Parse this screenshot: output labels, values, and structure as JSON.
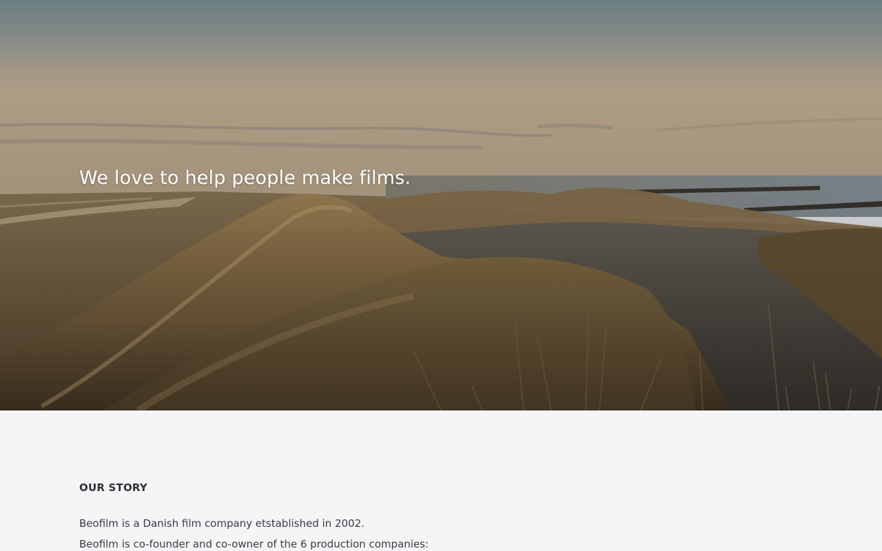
{
  "hero": {
    "heading": "We love to help people make films.",
    "image": "dune-landscape-photo"
  },
  "story": {
    "title": "OUR STORY",
    "paragraphs": [
      "Beofilm is a Danish film company etstablished in 2002.",
      "Beofilm is co-founder and co-owner of the 6 production companies:"
    ]
  },
  "colors": {
    "page_background": "#f4f5f7",
    "hero_text": "#ffffff",
    "body_text": "#3a3c40"
  }
}
